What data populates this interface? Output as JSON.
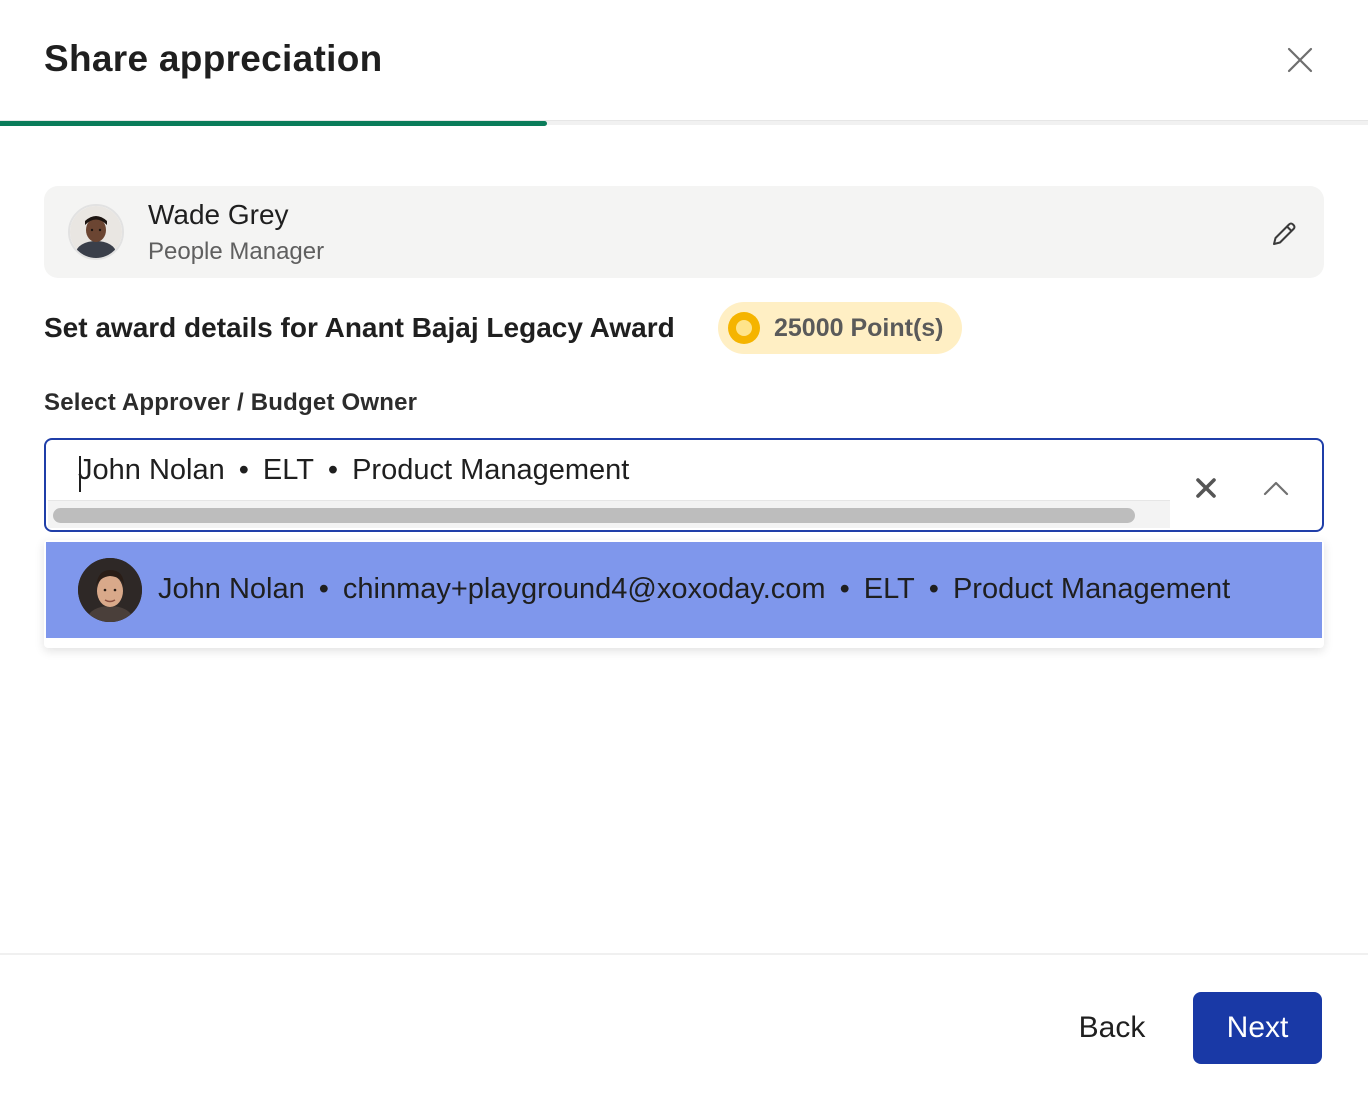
{
  "dialog": {
    "title": "Share appreciation",
    "progress_fraction": 0.4
  },
  "recipient": {
    "name": "Wade Grey",
    "role": "People Manager",
    "avatar_icon": "person-photo-avatar"
  },
  "award": {
    "heading": "Set award details for Anant Bajaj Legacy Award",
    "points": "25000 Point(s)"
  },
  "approver": {
    "label": "Select Approver / Budget Owner",
    "value_parts": [
      "John Nolan",
      "ELT",
      "Product Management"
    ],
    "separator": "•"
  },
  "dropdown": {
    "options": [
      {
        "name": "John Nolan",
        "email": "chinmay+playground4@xoxoday.com",
        "team": "ELT",
        "department": "Product Management",
        "highlighted": true
      }
    ]
  },
  "footer": {
    "back_label": "Back",
    "next_label": "Next"
  },
  "colors": {
    "primary": "#1939a6",
    "progress": "#0a7c5a",
    "option_highlight": "#7f97ec",
    "points_badge_bg": "#ffefc4",
    "coin": "#f5b400"
  }
}
